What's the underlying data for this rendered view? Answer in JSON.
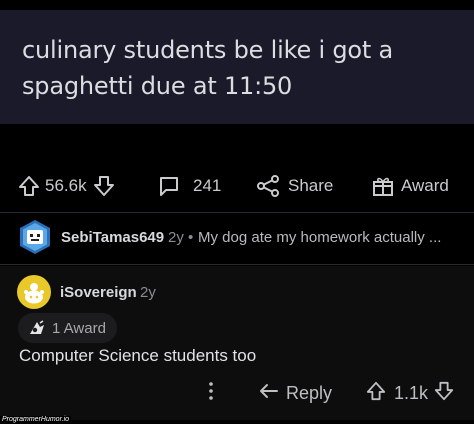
{
  "post": {
    "line1": "culinary students be like i got a",
    "line2": "spaghetti due at 11:50"
  },
  "post_actions": {
    "upvotes": "56.6k",
    "comments": "241",
    "share_label": "Share",
    "award_label": "Award"
  },
  "top_comment": {
    "username": "SebiTamas649",
    "age": "2y",
    "separator": "•",
    "snippet": "My dog ate my homework actually ..."
  },
  "reply": {
    "username": "iSovereign",
    "age": "2y",
    "award_count_label": "1 Award",
    "body": "Computer Science students too",
    "reply_label": "Reply",
    "votes": "1.1k"
  },
  "watermark": "ProgrammerHumor.io",
  "colors": {
    "post_bg": "#1a1a2a",
    "page_bg": "#000000",
    "avatar_yellow": "#e9c82a"
  }
}
